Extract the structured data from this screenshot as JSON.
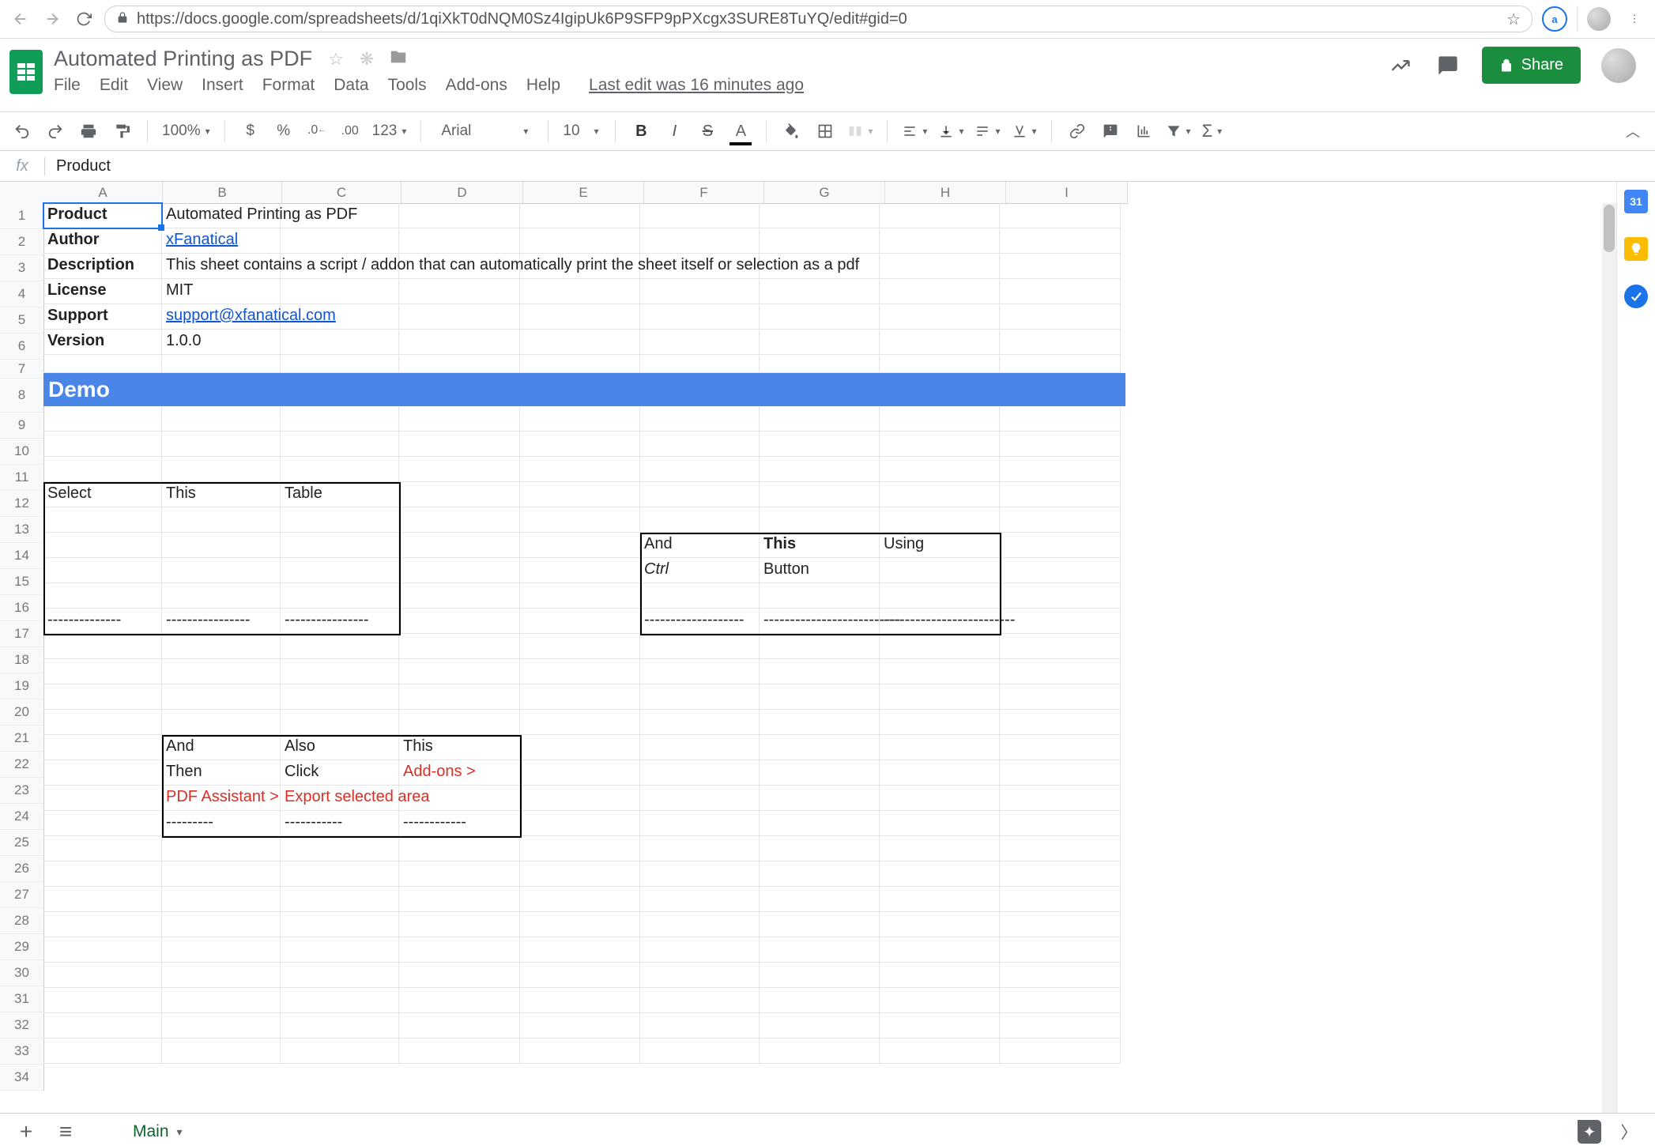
{
  "browser": {
    "url": "https://docs.google.com/spreadsheets/d/1qiXkT0dNQM0Sz4IgipUk6P9SFP9pPXcgx3SURE8TuYQ/edit#gid=0",
    "ext_badge": "a"
  },
  "doc": {
    "title": "Automated Printing as PDF",
    "last_edit": "Last edit was 16 minutes ago",
    "share_label": "Share"
  },
  "menubar": [
    "File",
    "Edit",
    "View",
    "Insert",
    "Format",
    "Data",
    "Tools",
    "Add-ons",
    "Help"
  ],
  "toolbar": {
    "zoom": "100%",
    "currency_123": "123",
    "font": "Arial",
    "font_size": "10"
  },
  "fx": {
    "label": "fx",
    "value": "Product"
  },
  "columns": [
    "A",
    "B",
    "C",
    "D",
    "E",
    "F",
    "G",
    "H",
    "I"
  ],
  "rows": [
    "1",
    "2",
    "3",
    "4",
    "5",
    "6",
    "7",
    "8",
    "9",
    "10",
    "11",
    "12",
    "13",
    "14",
    "15",
    "16",
    "17",
    "18",
    "19",
    "20",
    "21",
    "22",
    "23",
    "24",
    "25",
    "26",
    "27",
    "28",
    "29",
    "30",
    "31",
    "32",
    "33",
    "34"
  ],
  "cells": {
    "A1": "Product",
    "B1": "Automated Printing as PDF",
    "A2": "Author",
    "B2": "xFanatical",
    "A3": "Description",
    "B3": "This sheet contains a script / addon that can automatically print the sheet itself or selection as a pdf",
    "A4": "License",
    "B4": "MIT",
    "A5": "Support",
    "B5": "support@xfanatical.com",
    "A6": "Version",
    "B6": "1.0.0",
    "A8": "Demo",
    "A12": "Select",
    "B12": "This",
    "C12": "Table",
    "A17": "--------------",
    "B17": "----------------",
    "C17": "----------------",
    "F14": "And",
    "G14": "This",
    "H14": "Using",
    "F15": "Ctrl",
    "G15": "Button",
    "F17": "-------------------",
    "G17": "--------------------------",
    "H17": "-------------------------",
    "B22": "And",
    "C22": "Also",
    "D22": "This",
    "B23": "Then",
    "C23": "Click",
    "D23": "Add-ons >",
    "B24": "PDF Assistant >",
    "C24": "Export selected area",
    "B25": "---------",
    "C25": "-----------",
    "D25": "------------"
  },
  "side_panel": {
    "calendar": "31"
  },
  "tabs": {
    "main_label": "Main"
  }
}
